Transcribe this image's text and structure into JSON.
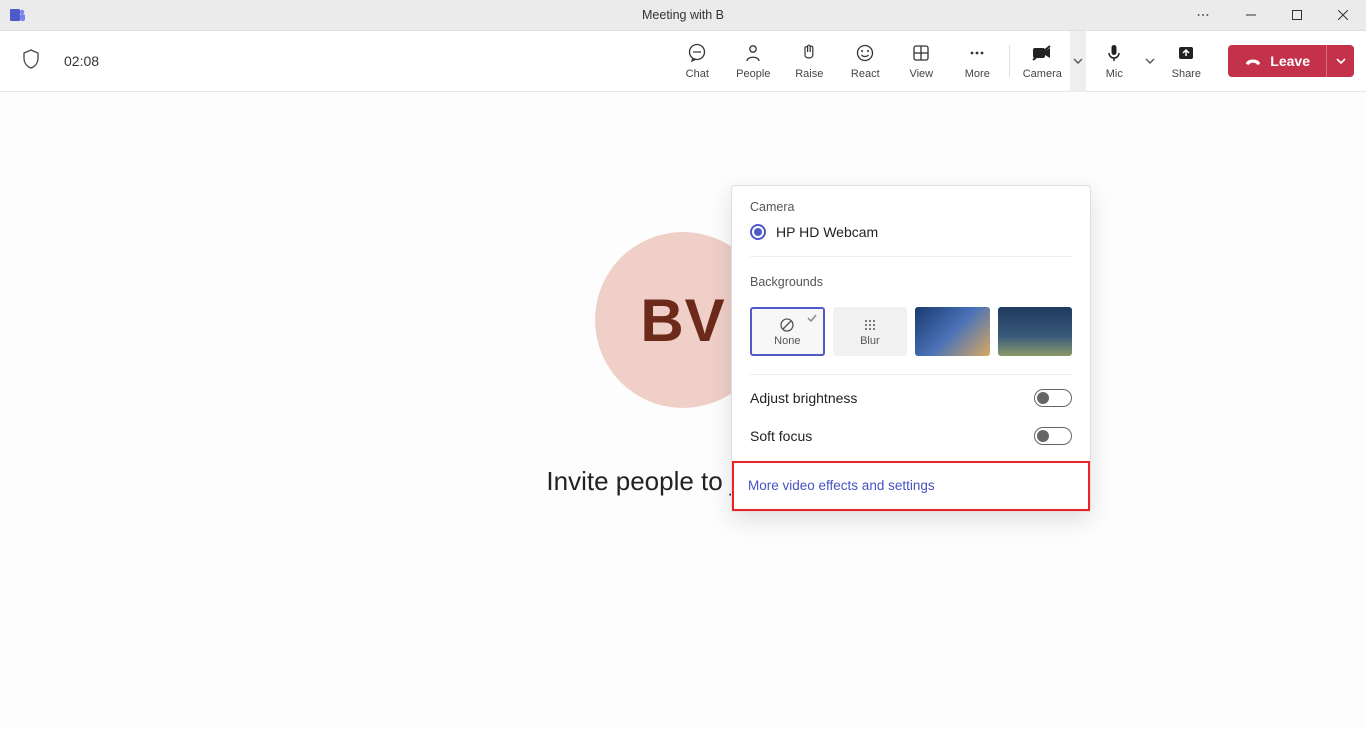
{
  "titlebar": {
    "title": "Meeting with B"
  },
  "toolbar": {
    "timer": "02:08",
    "buttons": {
      "chat": "Chat",
      "people": "People",
      "raise": "Raise",
      "react": "React",
      "view": "View",
      "more": "More",
      "camera": "Camera",
      "mic": "Mic",
      "share": "Share"
    },
    "leave": "Leave"
  },
  "main": {
    "avatar_initials": "BV",
    "invite": "Invite people to join you"
  },
  "camera_panel": {
    "camera_heading": "Camera",
    "camera_device": "HP HD Webcam",
    "backgrounds_heading": "Backgrounds",
    "bg_none": "None",
    "bg_blur": "Blur",
    "adjust_brightness": "Adjust brightness",
    "soft_focus": "Soft focus",
    "more_link": "More video effects and settings"
  }
}
